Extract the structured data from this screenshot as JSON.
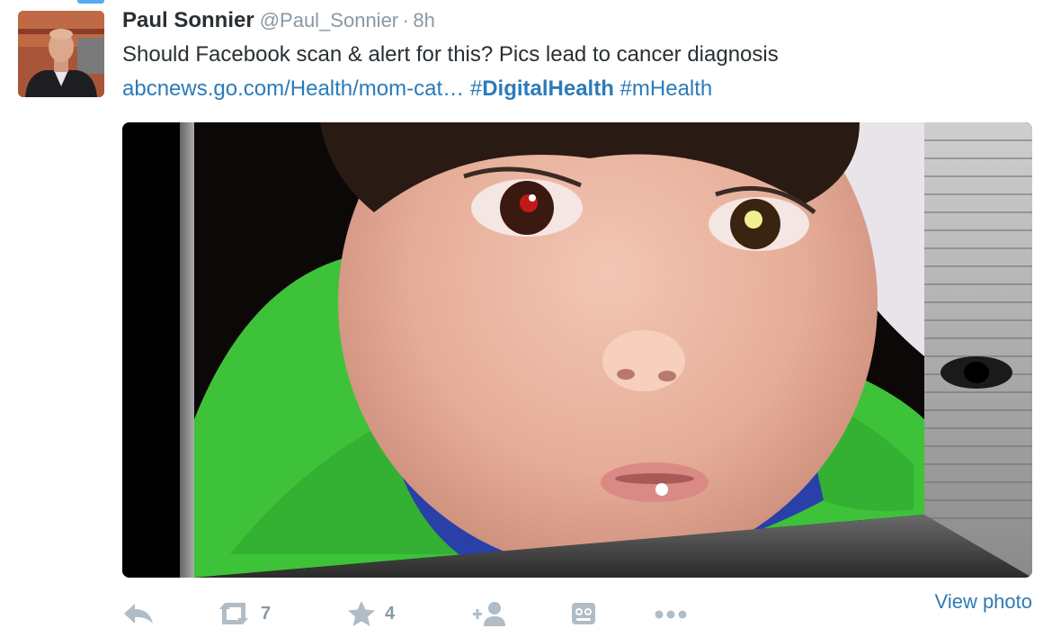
{
  "tweet": {
    "author_name": "Paul Sonnier",
    "handle": "@Paul_Sonnier",
    "separator": "·",
    "time": "8h",
    "text": "Should Facebook scan & alert for this? Pics lead to cancer diagnosis",
    "link": "abcnews.go.com/Health/mom-cat…",
    "hashtag_1": "#DigitalHealth",
    "hashtag_2": "#mHealth"
  },
  "actions": {
    "reply_icon": "reply-icon",
    "retweet_icon": "retweet-icon",
    "retweet_count": "7",
    "favorite_icon": "star-icon",
    "favorite_count": "4",
    "follow_icon": "add-user-icon",
    "media_icon": "media-viewer-icon",
    "more_icon": "more-dots-icon",
    "view_photo": "View photo"
  },
  "colors": {
    "link_blue": "#2b7bb9",
    "text_dark": "#292f33",
    "muted_gray": "#8899a6",
    "icon_gray": "#b0bcc6"
  }
}
